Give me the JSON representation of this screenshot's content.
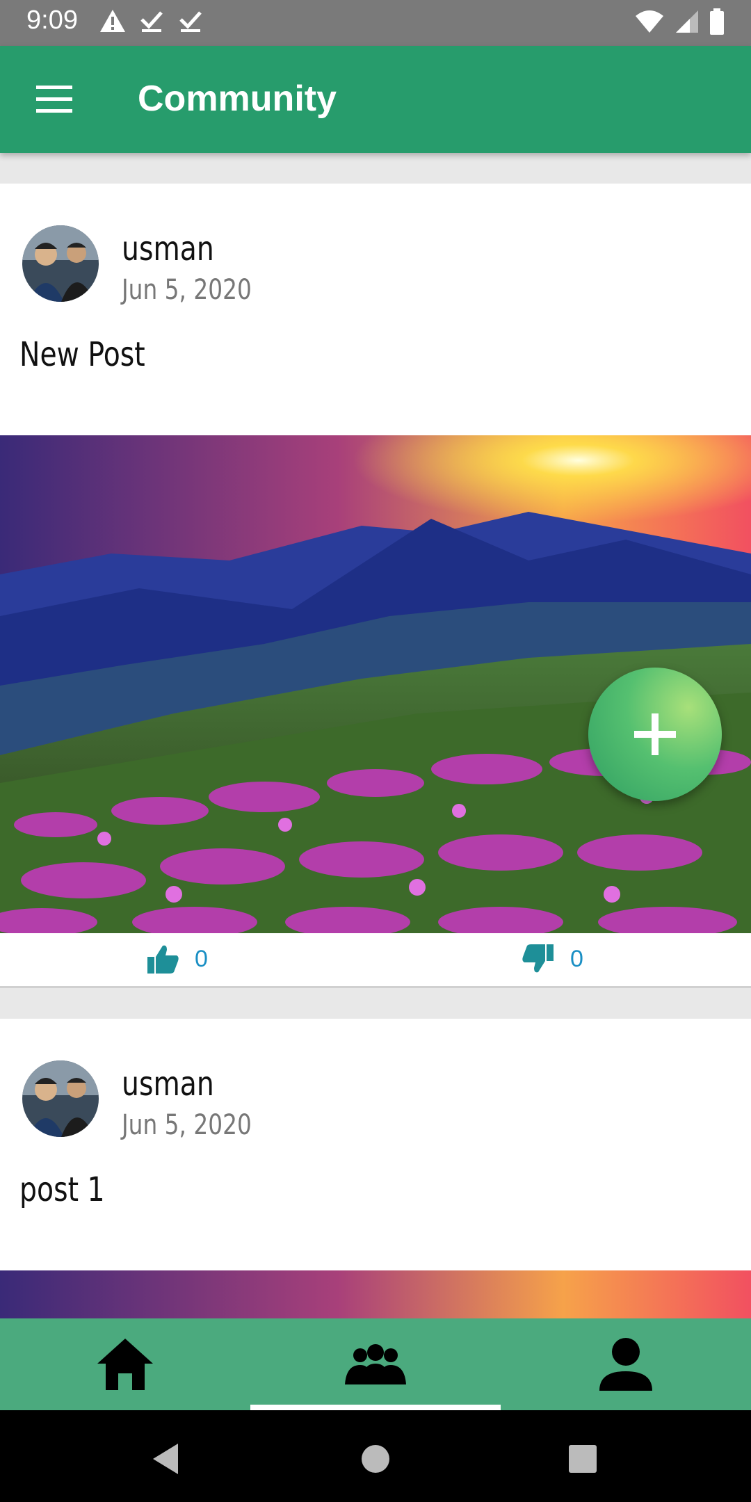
{
  "status_bar": {
    "time": "9:09",
    "icons": [
      "warning-icon",
      "download-done-icon",
      "download-done-icon",
      "wifi-icon",
      "cell-signal-icon",
      "battery-icon"
    ]
  },
  "app_bar": {
    "title": "Community",
    "menu_icon": "menu-icon"
  },
  "posts": [
    {
      "username": "usman",
      "date": "Jun 5, 2020",
      "text": "New Post",
      "likes": "0",
      "dislikes": "0",
      "image": "sunset-mountain-flowers"
    },
    {
      "username": "usman",
      "date": "Jun 5, 2020",
      "text": "post 1",
      "image": "sunset-mountain-flowers"
    }
  ],
  "fab": {
    "icon": "plus-icon"
  },
  "bottom_nav": {
    "items": [
      "home-icon",
      "community-icon",
      "profile-icon"
    ],
    "selected_index": 1
  },
  "system_nav": [
    "back-icon",
    "home-circle-icon",
    "recents-icon"
  ],
  "colors": {
    "app_bar": "#279c6c",
    "bottom_nav": "#4baa7e",
    "action_blue": "#1a8fc4",
    "reaction_teal": "#1e8f98"
  }
}
